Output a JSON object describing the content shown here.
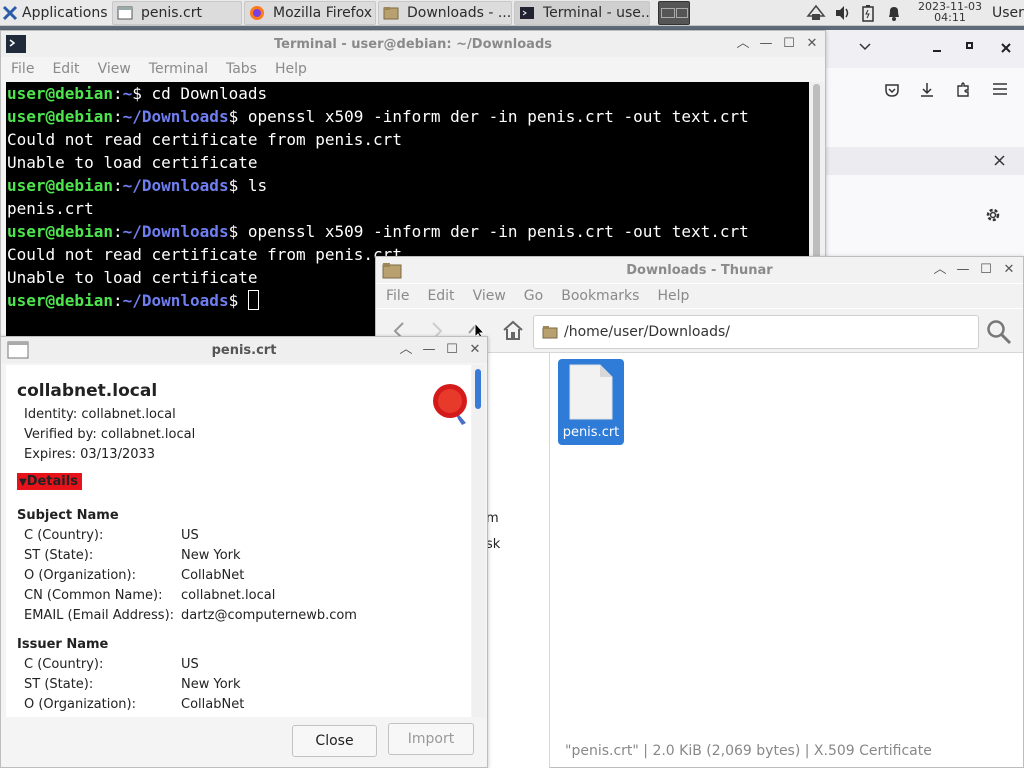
{
  "panel": {
    "applications_label": "Applications",
    "tasks": [
      {
        "label": "penis.crt",
        "icon": "window-icon"
      },
      {
        "label": "Mozilla Firefox",
        "icon": "firefox-icon"
      },
      {
        "label": "Downloads - ...",
        "icon": "folder-icon"
      },
      {
        "label": "Terminal - use...",
        "icon": "terminal-icon"
      }
    ],
    "clock_date": "2023-11-03",
    "clock_time": "04:11",
    "user_label": "User"
  },
  "terminal": {
    "title": "Terminal - user@debian: ~/Downloads",
    "menu": [
      "File",
      "Edit",
      "View",
      "Terminal",
      "Tabs",
      "Help"
    ],
    "prompt_user": "user@debian",
    "lines": [
      {
        "type": "prompt",
        "path": "~",
        "cmd": "cd Downloads"
      },
      {
        "type": "prompt",
        "path": "~/Downloads",
        "cmd": "openssl x509 -inform der -in penis.crt -out text.crt"
      },
      {
        "type": "out",
        "text": "Could not read certificate from penis.crt"
      },
      {
        "type": "out",
        "text": "Unable to load certificate"
      },
      {
        "type": "prompt",
        "path": "~/Downloads",
        "cmd": "ls"
      },
      {
        "type": "out",
        "text": "penis.crt"
      },
      {
        "type": "prompt",
        "path": "~/Downloads",
        "cmd": "openssl x509 -inform der -in penis.crt -out text.crt"
      },
      {
        "type": "out",
        "text": "Could not read certificate from penis.crt"
      },
      {
        "type": "out",
        "text": "Unable to load certificate"
      },
      {
        "type": "prompt",
        "path": "~/Downloads",
        "cmd": "",
        "cursor": true
      }
    ]
  },
  "thunar": {
    "title": "Downloads - Thunar",
    "menu": [
      "File",
      "Edit",
      "View",
      "Go",
      "Bookmarks",
      "Help"
    ],
    "address": "/home/user/Downloads/",
    "side_fragments": [
      "m",
      "sk"
    ],
    "file_name": "penis.crt",
    "status": "\"penis.crt\"  |  2.0 KiB (2,069 bytes)  |  X.509 Certificate"
  },
  "cert": {
    "title": "penis.crt",
    "name": "collabnet.local",
    "identity": "Identity: collabnet.local",
    "verified": "Verified by: collabnet.local",
    "expires": "Expires: 03/13/2033",
    "details_label": "Details",
    "subject_heading": "Subject Name",
    "subject": [
      {
        "k": "C (Country):",
        "v": "US"
      },
      {
        "k": "ST (State):",
        "v": "New York"
      },
      {
        "k": "O (Organization):",
        "v": "CollabNet"
      },
      {
        "k": "CN (Common Name):",
        "v": "collabnet.local"
      },
      {
        "k": "EMAIL (Email Address):",
        "v": "dartz@computernewb.com"
      }
    ],
    "issuer_heading": "Issuer Name",
    "issuer": [
      {
        "k": "C (Country):",
        "v": "US"
      },
      {
        "k": "ST (State):",
        "v": "New York"
      },
      {
        "k": "O (Organization):",
        "v": "CollabNet"
      }
    ],
    "close_label": "Close",
    "import_label": "Import"
  },
  "colors": {
    "prompt_user": "#4ee44e",
    "prompt_path": "#6f7ef0",
    "details_bg": "#e8121b",
    "selection": "#2f7cd8"
  }
}
